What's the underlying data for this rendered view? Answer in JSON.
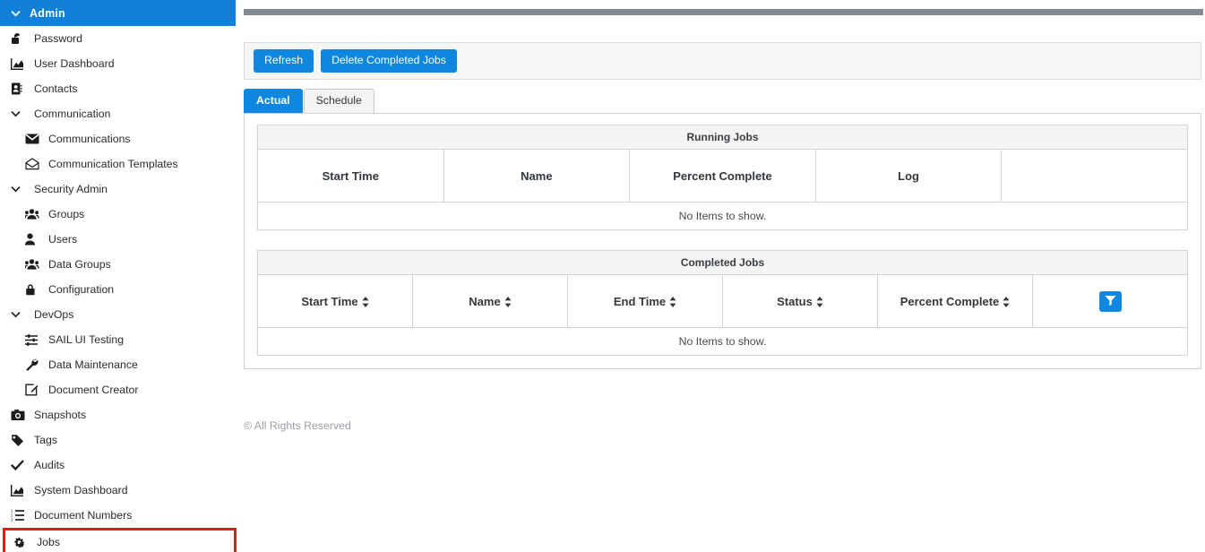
{
  "sidebar": {
    "header": {
      "label": "Admin",
      "icon": "chevron-down-icon"
    },
    "items": [
      {
        "label": "Password",
        "icon": "unlock-icon",
        "level": "top",
        "type": "link"
      },
      {
        "label": "User Dashboard",
        "icon": "chart-area-icon",
        "level": "top",
        "type": "link"
      },
      {
        "label": "Contacts",
        "icon": "address-book-icon",
        "level": "top",
        "type": "link"
      },
      {
        "label": "Communication",
        "icon": "chevron-down-icon",
        "level": "top",
        "type": "group"
      },
      {
        "label": "Communications",
        "icon": "envelope-icon",
        "level": "child",
        "type": "link"
      },
      {
        "label": "Communication Templates",
        "icon": "envelope-open-icon",
        "level": "child",
        "type": "link"
      },
      {
        "label": "Security Admin",
        "icon": "chevron-down-icon",
        "level": "top",
        "type": "group"
      },
      {
        "label": "Groups",
        "icon": "users-icon",
        "level": "child",
        "type": "link"
      },
      {
        "label": "Users",
        "icon": "user-icon",
        "level": "child",
        "type": "link"
      },
      {
        "label": "Data Groups",
        "icon": "users-icon",
        "level": "child",
        "type": "link"
      },
      {
        "label": "Configuration",
        "icon": "lock-icon",
        "level": "child",
        "type": "link"
      },
      {
        "label": "DevOps",
        "icon": "chevron-down-icon",
        "level": "top",
        "type": "group"
      },
      {
        "label": "SAIL UI Testing",
        "icon": "sliders-icon",
        "level": "child",
        "type": "link"
      },
      {
        "label": "Data Maintenance",
        "icon": "wrench-icon",
        "level": "child",
        "type": "link"
      },
      {
        "label": "Document Creator",
        "icon": "edit-square-icon",
        "level": "child",
        "type": "link"
      },
      {
        "label": "Snapshots",
        "icon": "camera-icon",
        "level": "top",
        "type": "link"
      },
      {
        "label": "Tags",
        "icon": "tag-icon",
        "level": "top",
        "type": "link"
      },
      {
        "label": "Audits",
        "icon": "check-icon",
        "level": "top",
        "type": "link"
      },
      {
        "label": "System Dashboard",
        "icon": "chart-area-icon",
        "level": "top",
        "type": "link"
      },
      {
        "label": "Document Numbers",
        "icon": "list-ol-icon",
        "level": "top",
        "type": "link"
      },
      {
        "label": "Jobs",
        "icon": "cogs-icon",
        "level": "top",
        "type": "link",
        "highlighted": true
      }
    ]
  },
  "toolbar": {
    "refresh_label": "Refresh",
    "delete_completed_label": "Delete Completed Jobs"
  },
  "tabs": [
    {
      "label": "Actual",
      "active": true
    },
    {
      "label": "Schedule",
      "active": false
    }
  ],
  "running_jobs": {
    "caption": "Running Jobs",
    "columns": [
      {
        "label": "Start Time",
        "sortable": false
      },
      {
        "label": "Name",
        "sortable": false
      },
      {
        "label": "Percent Complete",
        "sortable": false
      },
      {
        "label": "Log",
        "sortable": false
      },
      {
        "label": "",
        "sortable": false
      }
    ],
    "rows": [],
    "empty_text": "No Items to show."
  },
  "completed_jobs": {
    "caption": "Completed Jobs",
    "columns": [
      {
        "label": "Start Time",
        "sortable": true
      },
      {
        "label": "Name",
        "sortable": true
      },
      {
        "label": "End Time",
        "sortable": true
      },
      {
        "label": "Status",
        "sortable": true
      },
      {
        "label": "Percent Complete",
        "sortable": true
      },
      {
        "label": "",
        "sortable": false,
        "filter_button": true
      }
    ],
    "rows": [],
    "empty_text": "No Items to show.",
    "filter_icon": "filter-icon"
  },
  "footer": {
    "text": "© All Rights Reserved"
  },
  "colors": {
    "accent_blue": "#0d87e0",
    "header_blue": "#1081d6",
    "topbar_grey": "#818a94",
    "highlight_red": "#f31414",
    "panel_grey": "#f6f6f6",
    "caption_grey": "#f4f4f4"
  }
}
